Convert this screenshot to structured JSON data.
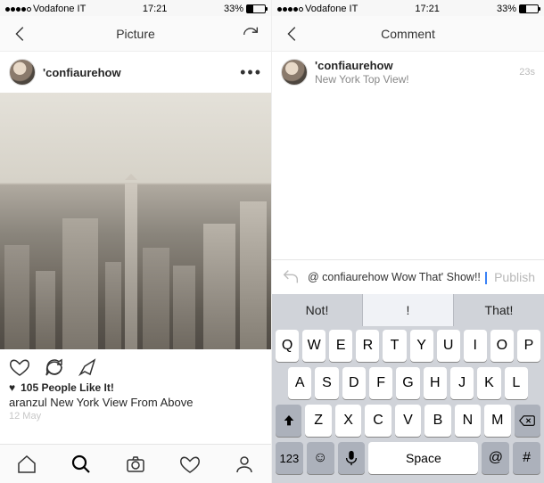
{
  "left": {
    "status": {
      "carrier": "Vodafone IT",
      "time": "17:21",
      "battery_pct": "33%",
      "battery_fill": 33
    },
    "header": {
      "title": "Picture"
    },
    "post": {
      "username": "'confiaurehow",
      "likes_count": "105 People Like It!",
      "caption_user": "aranzul",
      "caption_text": "New York View From Above",
      "date": "12 May"
    }
  },
  "right": {
    "status": {
      "carrier": "Vodafone IT",
      "time": "17:21",
      "battery_pct": "33%",
      "battery_fill": 33
    },
    "header": {
      "title": "Comment"
    },
    "post": {
      "username": "'confiaurehow",
      "subtitle": "New York Top View!",
      "timestamp": "23s"
    },
    "compose": {
      "mention": "@ confiaurehow",
      "draft": "Wow That' Show!!",
      "publish_label": "Publish"
    },
    "suggestions": [
      "Not!",
      "!",
      "That!"
    ],
    "keyboard": {
      "row1": [
        "Q",
        "W",
        "E",
        "R",
        "T",
        "Y",
        "U",
        "I",
        "O",
        "P"
      ],
      "row2": [
        "A",
        "S",
        "D",
        "F",
        "G",
        "H",
        "J",
        "K",
        "L"
      ],
      "row3": [
        "Z",
        "X",
        "C",
        "V",
        "B",
        "N",
        "M"
      ],
      "mode_key": "123",
      "space": "Space",
      "at_key": "@",
      "hash_key": "#"
    }
  }
}
